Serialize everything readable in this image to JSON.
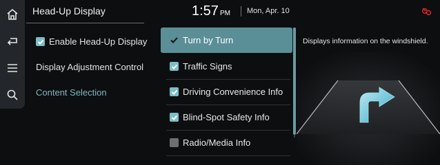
{
  "header": {
    "title": "Head-Up Display",
    "time": "1:57",
    "ampm": "PM",
    "date": "Mon, Apr. 10"
  },
  "rail": {
    "icons": [
      "home-icon",
      "back-icon",
      "menu-icon",
      "search-icon"
    ]
  },
  "left_menu": {
    "enable_label": "Enable Head-Up Display",
    "enable_checked": true,
    "adjust_label": "Display Adjustment Control",
    "content_label": "Content Selection"
  },
  "content_list": {
    "items": [
      {
        "label": "Turn by Turn",
        "checked": true,
        "selected": true
      },
      {
        "label": "Traffic Signs",
        "checked": true
      },
      {
        "label": "Driving Convenience Info",
        "checked": true
      },
      {
        "label": "Blind-Spot Safety Info",
        "checked": true
      },
      {
        "label": "Radio/Media Info",
        "checked": false
      }
    ]
  },
  "description": "Displays information on the windshield.",
  "colors": {
    "accent": "#7cbec6",
    "selected_row": "#5b8f97",
    "status_icon": "#e0242b"
  }
}
